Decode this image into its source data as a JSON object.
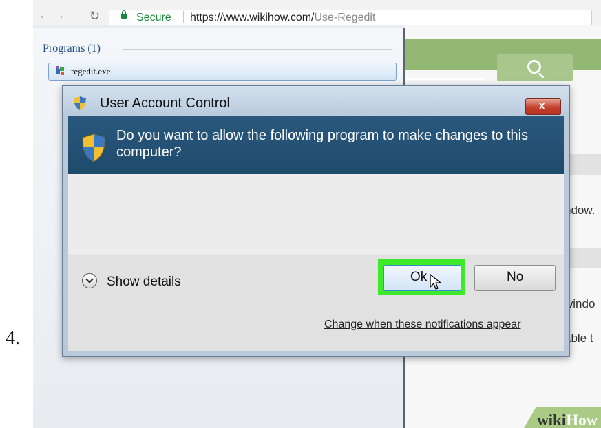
{
  "step": {
    "number": "4."
  },
  "browser": {
    "secure_label": "Secure",
    "url_host": "https://www.wikihow.com/",
    "url_path": "Use-Regedit"
  },
  "start_menu": {
    "section_label": "Programs (1)",
    "result_label": "regedit.exe"
  },
  "dialog": {
    "title": "User Account Control",
    "close_label": "x",
    "question": "Do you want to allow the following program to make changes to this computer?",
    "details_label": "Show details",
    "yes_label": "Ok",
    "no_label": "No",
    "change_link": "Change when these notifications appear"
  },
  "page_fragments": {
    "line1": "ndow.",
    "line2": "windo",
    "line3": "able t"
  },
  "watermark": {
    "wiki": "wiki",
    "how": "How"
  },
  "colors": {
    "highlight": "#3ee82a",
    "dialog_header": "#1e4a6b",
    "wikihow_green": "#93b874"
  },
  "icons": [
    "uac-shield-icon",
    "close-icon",
    "chevron-down-icon",
    "search-icon",
    "regedit-icon",
    "pointer-cursor-icon",
    "lock-icon"
  ]
}
